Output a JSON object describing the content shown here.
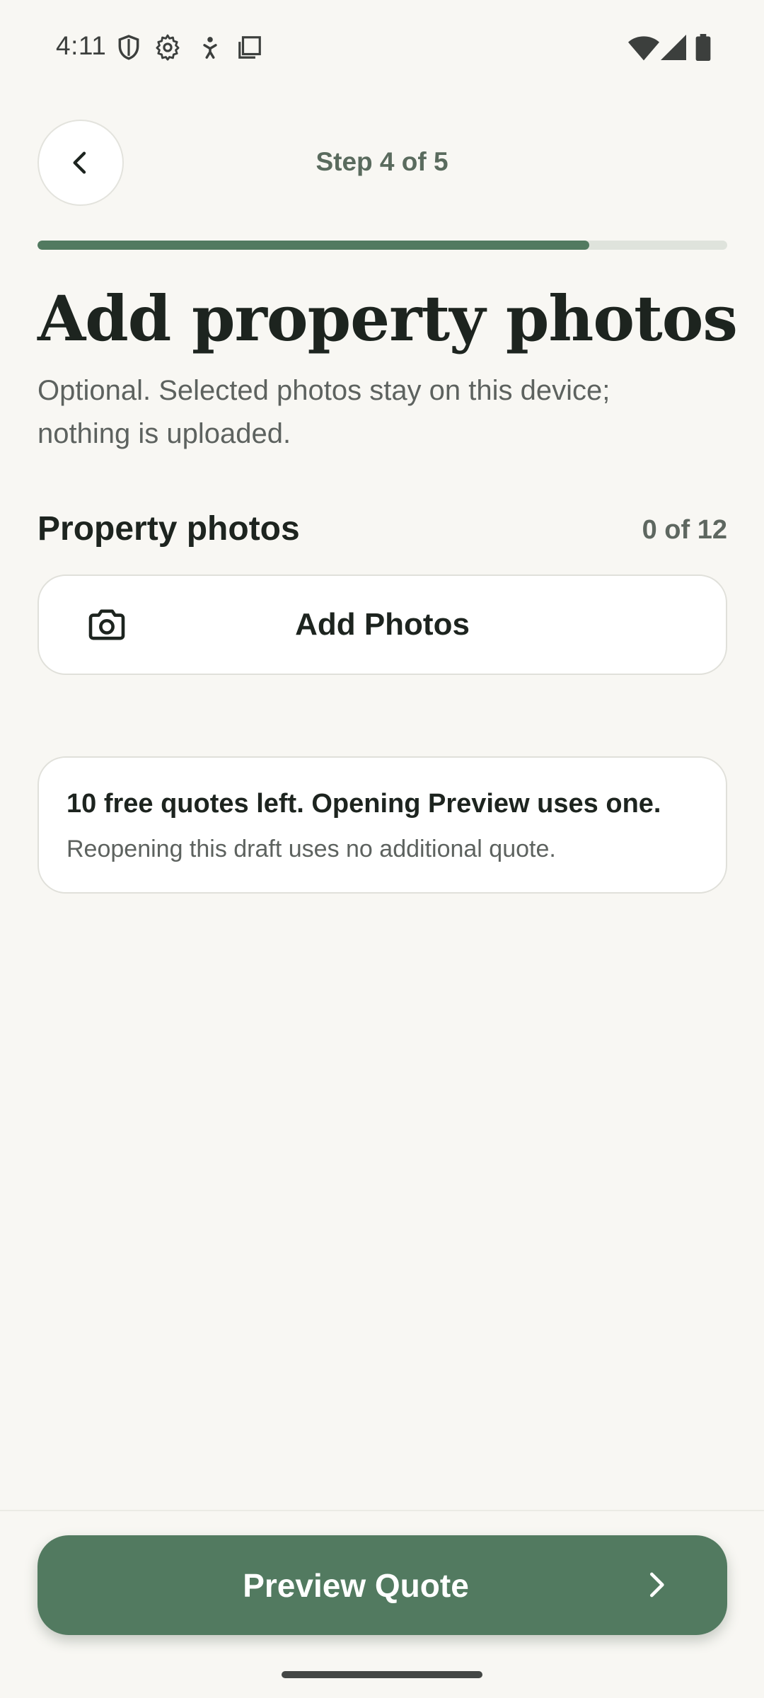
{
  "status_bar": {
    "time": "4:11",
    "icons_left": [
      "shield-icon",
      "gear-icon",
      "accessibility-icon",
      "screenshot-icon"
    ],
    "icons_right": [
      "wifi-icon",
      "cellular-signal-icon",
      "battery-icon"
    ]
  },
  "header": {
    "back_icon": "chevron-left-icon",
    "step_label": "Step 4 of 5",
    "progress_fraction": 0.8
  },
  "page": {
    "title": "Add property photos",
    "subtitle": "Optional. Selected photos stay on this device; nothing is uploaded."
  },
  "photos": {
    "section_label": "Property photos",
    "count": "0 of 12",
    "add_button_label": "Add Photos",
    "add_button_icon": "camera-icon"
  },
  "quota": {
    "title": "10 free quotes left. Opening Preview uses one.",
    "note": "Reopening this draft uses no additional quote."
  },
  "footer": {
    "preview_label": "Preview Quote",
    "preview_icon": "chevron-right-icon"
  },
  "colors": {
    "background": "#f8f7f3",
    "accent": "#527a60",
    "progress_track": "#dfe3dc",
    "text_primary": "#1d241f",
    "text_secondary": "#5d625f"
  }
}
